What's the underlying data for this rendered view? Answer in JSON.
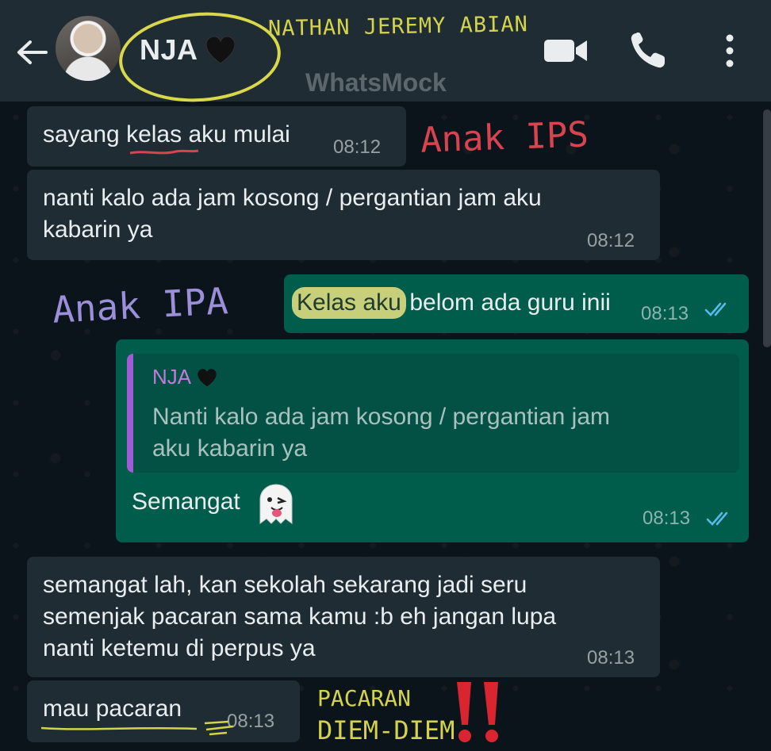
{
  "header": {
    "contact_name": "NJA",
    "full_name_annotation": "NATHAN JEREMY ABIAN",
    "watermark": "WhatsMock",
    "icons": [
      "back-arrow-icon",
      "avatar",
      "black-heart-icon",
      "video-call-icon",
      "voice-call-icon",
      "more-menu-icon"
    ]
  },
  "messages": [
    {
      "id": "m1",
      "direction": "incoming",
      "text": "sayang kelas aku mulai",
      "time": "08:12",
      "annotation": "Anak IPS"
    },
    {
      "id": "m2",
      "direction": "incoming",
      "text": "nanti kalo ada jam kosong / pergantian jam aku kabarin ya",
      "time": "08:12"
    },
    {
      "id": "m3",
      "direction": "outgoing",
      "text_highlight": "Kelas aku",
      "text_rest": " belom ada guru inii",
      "time": "08:13",
      "annotation": "Anak IPA",
      "read": true
    },
    {
      "id": "m4",
      "direction": "outgoing",
      "quote_name": "NJA",
      "quote_text": "Nanti kalo ada jam kosong / pergantian jam aku kabarin ya",
      "text": "Semangat",
      "emoji": "ghost-tongue-emoji",
      "time": "08:13",
      "read": true
    },
    {
      "id": "m5",
      "direction": "incoming",
      "text": "semangat lah, kan sekolah sekarang jadi seru semenjak pacaran sama kamu :b eh jangan lupa nanti ketemu di perpus ya",
      "time": "08:13"
    },
    {
      "id": "m6",
      "direction": "incoming",
      "text": "mau pacaran",
      "time": "08:13",
      "annotation_line1": "PACARAN",
      "annotation_line2": "DIEM-DIEM"
    }
  ],
  "colors": {
    "header_bg": "#1f2c34",
    "chat_bg": "#0b141a",
    "incoming_bubble": "#1f2c34",
    "outgoing_bubble": "#005c4b",
    "read_ticks": "#53bdeb",
    "quote_bar": "#a05cd6",
    "annot_yellow": "#d4d34b",
    "annot_red": "#d8434f",
    "annot_purple": "#9a8fd8"
  }
}
